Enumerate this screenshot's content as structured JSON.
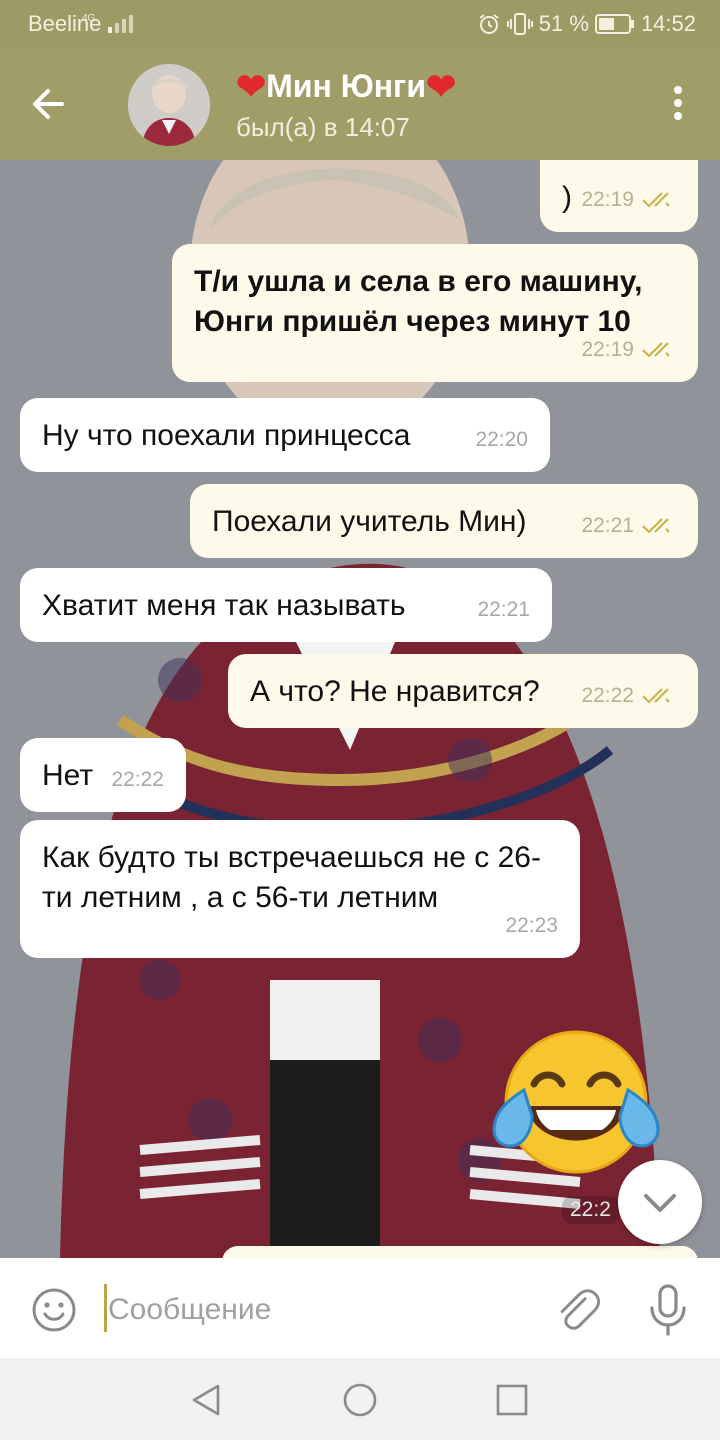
{
  "status_bar": {
    "carrier": "Beeline",
    "network": "4G",
    "battery": "51 %",
    "time": "14:52"
  },
  "header": {
    "heart_left": "❤",
    "contact_name": "Мин Юнги",
    "heart_right": "❤",
    "last_seen": "был(а) в 14:07"
  },
  "messages": [
    {
      "direction": "out",
      "text": ")",
      "time": "22:19",
      "read": true
    },
    {
      "direction": "out",
      "text": "Т/и ушла и села в его машину, Юнги пришёл через минут 10",
      "time": "22:19",
      "read": true
    },
    {
      "direction": "in",
      "text": "Ну что поехали принцесса",
      "time": "22:20"
    },
    {
      "direction": "out",
      "text": "Поехали учитель Мин)",
      "time": "22:21",
      "read": true
    },
    {
      "direction": "in",
      "text": "Хватит меня так называть",
      "time": "22:21"
    },
    {
      "direction": "out",
      "text": "А что? Не нравится?",
      "time": "22:22",
      "read": true
    },
    {
      "direction": "in",
      "text": "Нет",
      "time": "22:22"
    },
    {
      "direction": "in",
      "text": "Как будто ты встречаешься не с 26-ти летним , а с 56-ти летним",
      "time": "22:23"
    },
    {
      "direction": "out",
      "type": "emoji",
      "emoji": "face-with-tears-of-joy",
      "time": "22:2"
    }
  ],
  "input": {
    "placeholder": "Сообщение"
  },
  "icons": {
    "back": "back-arrow-icon",
    "menu": "more-vert-icon",
    "emoji": "smile-icon",
    "attach": "paperclip-icon",
    "mic": "microphone-icon",
    "scroll": "chevron-down-icon"
  },
  "colors": {
    "header": "#a19d68",
    "status_bar": "#9e9a66",
    "outgoing_bubble": "#fefaea",
    "incoming_bubble": "#ffffff",
    "read_ticks": "#c9b451",
    "heart": "#e0282d"
  }
}
